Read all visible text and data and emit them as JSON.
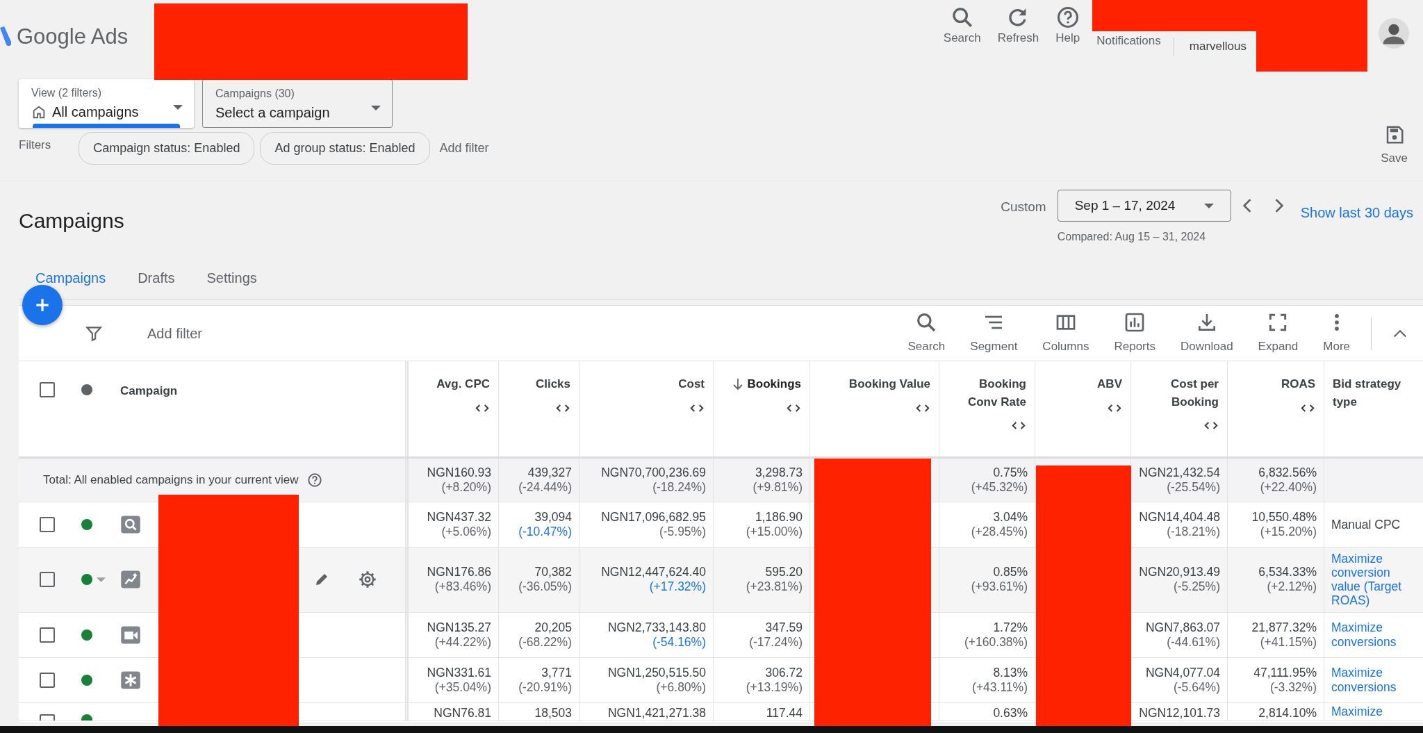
{
  "header": {
    "product": "Google Ads",
    "actions": [
      {
        "kind": "search",
        "label": "Search"
      },
      {
        "kind": "refresh",
        "label": "Refresh"
      },
      {
        "kind": "help",
        "label": "Help"
      },
      {
        "kind": "notifications",
        "label": "Notifications"
      }
    ],
    "account": "marvellous"
  },
  "view_selector": {
    "label": "View (2 filters)",
    "value": "All campaigns"
  },
  "campaign_selector": {
    "label": "Campaigns (30)",
    "value": "Select a campaign"
  },
  "filters": {
    "label": "Filters",
    "chips": [
      "Campaign status: Enabled",
      "Ad group status: Enabled"
    ],
    "add_label": "Add filter"
  },
  "save": "Save",
  "title": "Campaigns",
  "date_range": {
    "label": "Custom",
    "value": "Sep 1 – 17, 2024",
    "compared": "Compared: Aug 15 – 31, 2024",
    "link": "Show last 30 days"
  },
  "tabs": [
    {
      "label": "Campaigns",
      "selected": true
    },
    {
      "label": "Drafts",
      "selected": false
    },
    {
      "label": "Settings",
      "selected": false
    }
  ],
  "table": {
    "add_filter": "Add filter",
    "tools": [
      {
        "kind": "search",
        "label": "Search"
      },
      {
        "kind": "segment",
        "label": "Segment"
      },
      {
        "kind": "columns",
        "label": "Columns"
      },
      {
        "kind": "reports",
        "label": "Reports"
      },
      {
        "kind": "download",
        "label": "Download"
      },
      {
        "kind": "expand",
        "label": "Expand"
      },
      {
        "kind": "more",
        "label": "More"
      }
    ],
    "select_all_checked": false,
    "campaign_header": "Campaign",
    "columns": [
      {
        "kind": "metric",
        "label": "Avg. CPC",
        "sorted": false
      },
      {
        "kind": "metric",
        "label": "Clicks",
        "sorted": false
      },
      {
        "kind": "metric",
        "label": "Cost",
        "sorted": false
      },
      {
        "kind": "metric",
        "label": "Bookings",
        "sorted": true
      },
      {
        "kind": "metric",
        "label": "Booking Value",
        "sorted": false
      },
      {
        "kind": "metric",
        "label": "Booking Conv Rate",
        "sorted": false
      },
      {
        "kind": "metric",
        "label": "ABV",
        "sorted": false
      },
      {
        "kind": "metric",
        "label": "Cost per Booking",
        "sorted": false
      },
      {
        "kind": "metric",
        "label": "ROAS",
        "sorted": false
      },
      {
        "kind": "text",
        "label": "Bid strategy type"
      }
    ],
    "total": {
      "label": "Total: All enabled campaigns in your current view",
      "cells": [
        {
          "value": "NGN160.93",
          "change": "(+8.20%)",
          "linked": false
        },
        {
          "value": "439,327",
          "change": "(-24.44%)",
          "linked": false
        },
        {
          "value": "NGN70,700,236.69",
          "change": "(-18.24%)",
          "linked": false
        },
        {
          "value": "3,298.73",
          "change": "(+9.81%)",
          "linked": false
        },
        null,
        {
          "value": "0.75%",
          "change": "(+45.32%)",
          "linked": false
        },
        null,
        {
          "value": "NGN21,432.54",
          "change": "(-25.54%)",
          "linked": false
        },
        {
          "value": "6,832.56%",
          "change": "(+22.40%)",
          "linked": false
        }
      ]
    },
    "rows": [
      {
        "checked": false,
        "color": "#188038",
        "kind": "search",
        "hovered": false,
        "bid": {
          "text": "Manual CPC",
          "link": false
        },
        "cells": [
          {
            "value": "NGN437.32",
            "change": "(+5.06%)",
            "linked": false
          },
          {
            "value": "39,094",
            "change": "(-10.47%)",
            "linked": true
          },
          {
            "value": "NGN17,096,682.95",
            "change": "(-5.95%)",
            "linked": false
          },
          {
            "value": "1,186.90",
            "change": "(+15.00%)",
            "linked": false
          },
          null,
          {
            "value": "3.04%",
            "change": "(+28.45%)",
            "linked": false
          },
          null,
          {
            "value": "NGN14,404.48",
            "change": "(-18.21%)",
            "linked": false
          },
          {
            "value": "10,550.48%",
            "change": "(+15.20%)",
            "linked": false
          }
        ]
      },
      {
        "checked": false,
        "color": "#188038",
        "kind": "display",
        "hovered": true,
        "bid": {
          "text": "Maximize conversion value (Target ROAS)",
          "link": true
        },
        "cells": [
          {
            "value": "NGN176.86",
            "change": "(+83.46%)",
            "linked": false
          },
          {
            "value": "70,382",
            "change": "(-36.05%)",
            "linked": false
          },
          {
            "value": "NGN12,447,624.40",
            "change": "(+17.32%)",
            "linked": true
          },
          {
            "value": "595.20",
            "change": "(+23.81%)",
            "linked": false
          },
          null,
          {
            "value": "0.85%",
            "change": "(+93.61%)",
            "linked": false
          },
          null,
          {
            "value": "NGN20,913.49",
            "change": "(-5.25%)",
            "linked": false
          },
          {
            "value": "6,534.33%",
            "change": "(+2.12%)",
            "linked": false
          }
        ]
      },
      {
        "checked": false,
        "color": "#188038",
        "kind": "video",
        "hovered": false,
        "bid": {
          "text": "Maximize conversions",
          "link": true
        },
        "cells": [
          {
            "value": "NGN135.27",
            "change": "(+44.22%)",
            "linked": false
          },
          {
            "value": "20,205",
            "change": "(-68.22%)",
            "linked": false
          },
          {
            "value": "NGN2,733,143.80",
            "change": "(-54.16%)",
            "linked": true
          },
          {
            "value": "347.59",
            "change": "(-17.24%)",
            "linked": false
          },
          null,
          {
            "value": "1.72%",
            "change": "(+160.38%)",
            "linked": false
          },
          null,
          {
            "value": "NGN7,863.07",
            "change": "(-44.61%)",
            "linked": false
          },
          {
            "value": "21,877.32%",
            "change": "(+41.15%)",
            "linked": false
          }
        ]
      },
      {
        "checked": false,
        "color": "#188038",
        "kind": "pmax",
        "hovered": false,
        "bid": {
          "text": "Maximize conversions",
          "link": true
        },
        "cells": [
          {
            "value": "NGN331.61",
            "change": "(+35.04%)",
            "linked": false
          },
          {
            "value": "3,771",
            "change": "(-20.91%)",
            "linked": false
          },
          {
            "value": "NGN1,250,515.50",
            "change": "(+6.80%)",
            "linked": false
          },
          {
            "value": "306.72",
            "change": "(+13.19%)",
            "linked": false
          },
          null,
          {
            "value": "8.13%",
            "change": "(+43.11%)",
            "linked": false
          },
          null,
          {
            "value": "NGN4,077.04",
            "change": "(-5.64%)",
            "linked": false
          },
          {
            "value": "47,111.95%",
            "change": "(-3.32%)",
            "linked": false
          }
        ]
      },
      {
        "checked": false,
        "color": "#188038",
        "hovered": false,
        "bid": {
          "text": "Maximize",
          "link": true
        },
        "cells": [
          {
            "value": "NGN76.81"
          },
          {
            "value": "18,503"
          },
          {
            "value": "NGN1,421,271.38"
          },
          {
            "value": "117.44"
          },
          null,
          {
            "value": "0.63%"
          },
          null,
          {
            "value": "NGN12,101.73"
          },
          {
            "value": "2,814.10%"
          }
        ]
      }
    ]
  }
}
